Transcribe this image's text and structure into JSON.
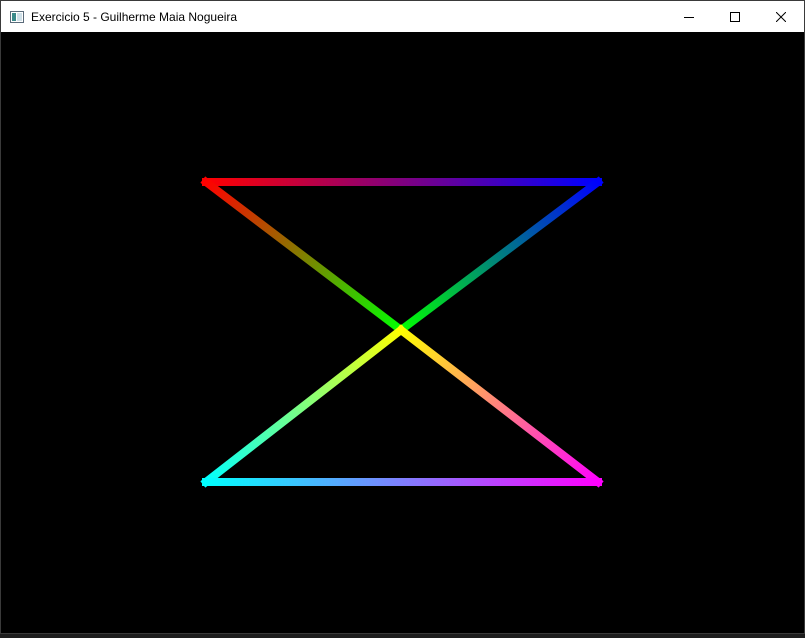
{
  "window": {
    "title": "Exercicio 5 - Guilherme Maia Nogueira",
    "app_icon": "application-window-icon",
    "controls": [
      "minimize-icon",
      "maximize-icon",
      "close-icon"
    ]
  },
  "canvas": {
    "background": "#000000",
    "figure": "hourglass-polyline",
    "vertex_colors": {
      "top_left": "#ff0000",
      "top_right": "#0000ff",
      "center_from_top": "#00ff00",
      "center_from_bottom": "#ffff00",
      "bottom_left": "#00ffff",
      "bottom_right": "#ff00ff"
    }
  }
}
